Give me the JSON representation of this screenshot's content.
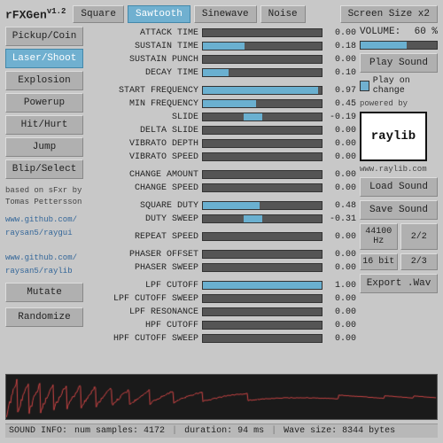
{
  "app": {
    "title": "rFXGen",
    "version": "v1.2"
  },
  "waveform_buttons": [
    {
      "label": "Square",
      "active": false
    },
    {
      "label": "Sawtooth",
      "active": true
    },
    {
      "label": "Sinewave",
      "active": false
    },
    {
      "label": "Noise",
      "active": false
    }
  ],
  "screen_size_btn": "Screen Size x2",
  "sidebar_buttons": [
    {
      "label": "Pickup/Coin",
      "active": false
    },
    {
      "label": "Laser/Shoot",
      "active": true
    },
    {
      "label": "Explosion",
      "active": false
    },
    {
      "label": "Powerup",
      "active": false
    },
    {
      "label": "Hit/Hurt",
      "active": false
    },
    {
      "label": "Jump",
      "active": false
    },
    {
      "label": "Blip/Select",
      "active": false
    }
  ],
  "credits": {
    "line1": "based on sFxr by",
    "line2": "Tomas Pettersson"
  },
  "links": [
    "www.github.com/",
    "raysan5/raygui",
    "",
    "www.github.com/",
    "raysan5/raylib"
  ],
  "action_buttons": [
    {
      "label": "Mutate"
    },
    {
      "label": "Randomize"
    }
  ],
  "params": [
    {
      "label": "ATTACK TIME",
      "value": "0.00",
      "bar": 0,
      "centered": false
    },
    {
      "label": "SUSTAIN TIME",
      "value": "0.18",
      "bar": 0.35,
      "centered": false
    },
    {
      "label": "SUSTAIN PUNCH",
      "value": "0.00",
      "bar": 0,
      "centered": false
    },
    {
      "label": "DECAY TIME",
      "value": "0.10",
      "bar": 0.22,
      "centered": false
    },
    {
      "spacer": true
    },
    {
      "label": "START FREQUENCY",
      "value": "0.97",
      "bar": 0.97,
      "centered": false
    },
    {
      "label": "MIN FREQUENCY",
      "value": "0.45",
      "bar": 0.45,
      "centered": false
    },
    {
      "label": "SLIDE",
      "value": "-0.19",
      "bar": 0.31,
      "centered": true,
      "neg": true
    },
    {
      "label": "DELTA SLIDE",
      "value": "0.00",
      "bar": 0,
      "centered": false
    },
    {
      "label": "VIBRATO DEPTH",
      "value": "0.00",
      "bar": 0,
      "centered": false
    },
    {
      "label": "VIBRATO SPEED",
      "value": "0.00",
      "bar": 0,
      "centered": false
    },
    {
      "spacer": true
    },
    {
      "label": "CHANGE AMOUNT",
      "value": "0.00",
      "bar": 0,
      "centered": false
    },
    {
      "label": "CHANGE SPEED",
      "value": "0.00",
      "bar": 0,
      "centered": false
    },
    {
      "spacer": true
    },
    {
      "label": "SQUARE DUTY",
      "value": "0.48",
      "bar": 0.48,
      "centered": false
    },
    {
      "label": "DUTY SWEEP",
      "value": "-0.31",
      "bar": 0.31,
      "centered": true,
      "neg": true
    },
    {
      "spacer": true
    },
    {
      "label": "REPEAT SPEED",
      "value": "0.00",
      "bar": 0,
      "centered": false
    },
    {
      "spacer": true
    },
    {
      "label": "PHASER OFFSET",
      "value": "0.00",
      "bar": 0,
      "centered": false
    },
    {
      "label": "PHASER SWEEP",
      "value": "0.00",
      "bar": 0,
      "centered": false
    },
    {
      "spacer": true
    },
    {
      "label": "LPF CUTOFF",
      "value": "1.00",
      "bar": 1.0,
      "centered": false
    },
    {
      "label": "LPF CUTOFF SWEEP",
      "value": "0.00",
      "bar": 0,
      "centered": false
    },
    {
      "label": "LPF RESONANCE",
      "value": "0.00",
      "bar": 0,
      "centered": false
    },
    {
      "label": "HPF CUTOFF",
      "value": "0.00",
      "bar": 0,
      "centered": false
    },
    {
      "label": "HPF CUTOFF SWEEP",
      "value": "0.00",
      "bar": 0,
      "centered": false
    }
  ],
  "right_panel": {
    "volume_label": "VOLUME:",
    "volume_percent": "60 %",
    "volume_value": 0.6,
    "play_sound_btn": "Play Sound",
    "play_on_change_label": "Play on change",
    "powered_by": "powered by",
    "raylib_text": "raylib",
    "raylib_url": "www.raylib.com",
    "load_sound_btn": "Load Sound",
    "save_sound_btn": "Save Sound",
    "freq_btn": "44100 Hz",
    "bit_fraction1": "2/2",
    "bit_label": "16 bit",
    "bit_fraction2": "2/3",
    "export_btn": "Export .Wav"
  },
  "status": {
    "samples_label": "SOUND INFO:",
    "samples_text": "num samples: 4172",
    "duration_text": "duration: 94 ms",
    "wave_size_text": "Wave size: 8344 bytes"
  }
}
